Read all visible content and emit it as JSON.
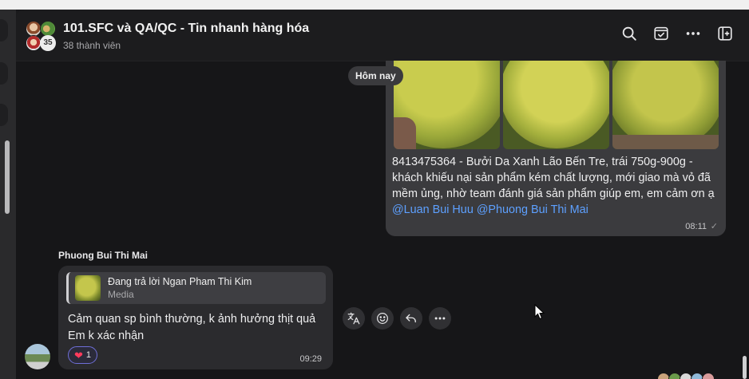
{
  "header": {
    "title": "101.SFC và QA/QC - Tin nhanh hàng hóa",
    "subtitle": "38 thành viên",
    "member_badge": "35",
    "icons": [
      "search-icon",
      "checklist-icon",
      "more-icon",
      "sidebar-toggle-icon"
    ]
  },
  "day_divider": "Hôm nay",
  "outgoing_message": {
    "text": "8413475364 - Bưởi Da Xanh Lão Bến Tre, trái 750g-900g - khách khiếu nại sản phẩm kém chất lượng, mới giao mà vỏ đã mềm ủng, nhờ team đánh giá sản phẩm giúp em, em cảm ơn ạ",
    "mentions": [
      "@Luan Bui Huu",
      "@Phuong Bui Thi Mai"
    ],
    "time": "08:11",
    "status_icon": "seen-check-icon"
  },
  "incoming_message": {
    "sender": "Phuong Bui Thi Mai",
    "reply_to": {
      "title": "Đang trả lời Ngan Pham Thi Kim",
      "kind": "Media"
    },
    "lines": [
      "Cảm quan sp bình thường, k ảnh hưởng thịt quả",
      "Em k xác nhận"
    ],
    "reaction": {
      "icon": "heart-icon",
      "count": "1"
    },
    "time": "09:29"
  },
  "message_actions": [
    "translate-icon",
    "emoji-icon",
    "reply-icon",
    "more-icon"
  ],
  "colors": {
    "background": "#161618",
    "bubble_out": "#3b3b3e",
    "bubble_in": "#2b2b2e",
    "mention": "#5da0ff",
    "heart": "#ff3b5c"
  }
}
